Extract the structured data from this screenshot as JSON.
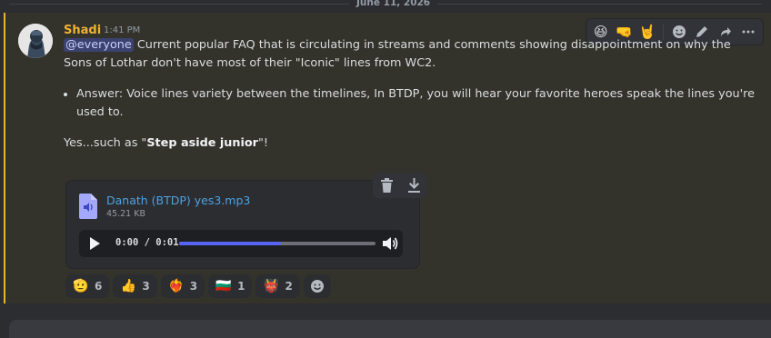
{
  "date_divider": "June 11, 2026",
  "message": {
    "author": "Shadi",
    "timestamp": "1:41 PM",
    "mention": "@everyone",
    "para1": "Current popular FAQ that is circulating in streams and comments showing disappointment on why the Sons of Lothar don't have most of their \"Iconic\" lines from WC2.",
    "bullet": "Answer: Voice lines variety between the timelines, In BTDP, you will hear your favorite heroes speak the lines you're used to.",
    "para3_prefix": "Yes...such as \"",
    "para3_bold": "Step aside junior",
    "para3_suffix": "\"!"
  },
  "attachment": {
    "file_name": "Danath (BTDP) yes3.mp3",
    "file_size": "45.21 KB",
    "time": "0:00 / 0:01",
    "progress_fraction": 0.52
  },
  "reactions": [
    {
      "emoji": "🫡",
      "count": "6"
    },
    {
      "emoji": "👍",
      "count": "3"
    },
    {
      "emoji": "❤️‍🔥",
      "count": "3"
    },
    {
      "emoji": "🇧🇬",
      "count": "1"
    },
    {
      "emoji": "👹",
      "count": "2"
    }
  ],
  "toolbar": {
    "emojis": [
      "😆",
      "🤜",
      "🤘"
    ]
  },
  "colors": {
    "username": "#f0b232",
    "accent": "#5865f2",
    "link": "#4ba3e3",
    "highlight_bg": "#33322b"
  }
}
